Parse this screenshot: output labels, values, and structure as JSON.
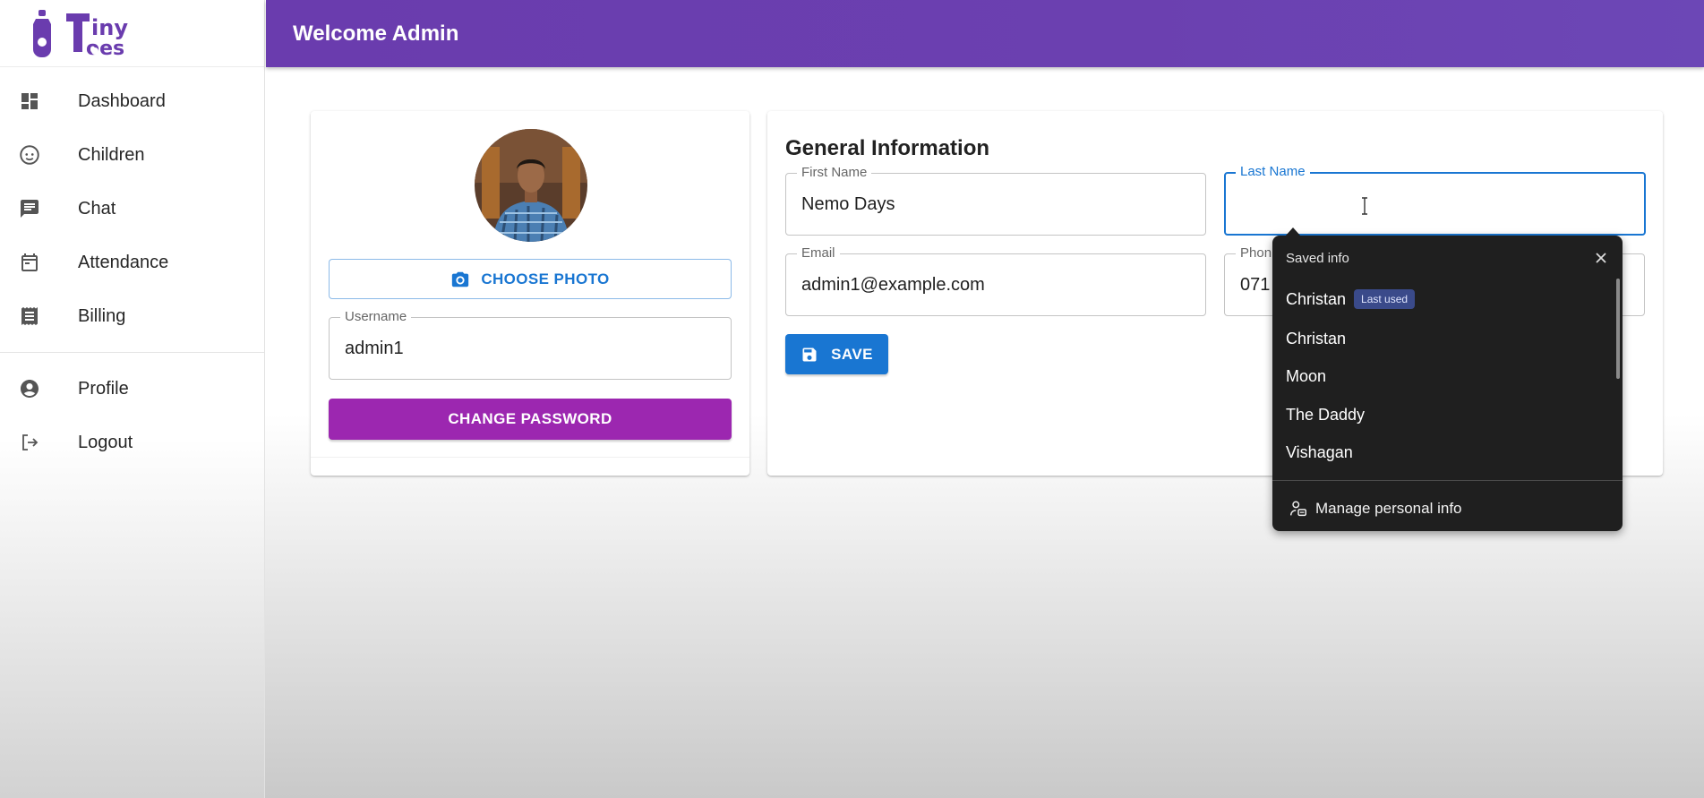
{
  "app": {
    "logo_text": "Tiny Toes",
    "header_title": "Welcome Admin"
  },
  "sidebar": {
    "items": [
      {
        "label": "Dashboard",
        "icon": "dashboard-icon"
      },
      {
        "label": "Children",
        "icon": "child-face-icon"
      },
      {
        "label": "Chat",
        "icon": "chat-icon"
      },
      {
        "label": "Attendance",
        "icon": "calendar-icon"
      },
      {
        "label": "Billing",
        "icon": "receipt-icon"
      }
    ],
    "secondary_items": [
      {
        "label": "Profile",
        "icon": "account-circle-icon"
      },
      {
        "label": "Logout",
        "icon": "logout-icon"
      }
    ]
  },
  "profile_card": {
    "choose_photo_label": "CHOOSE PHOTO",
    "username_label": "Username",
    "username_value": "admin1",
    "change_password_label": "CHANGE PASSWORD"
  },
  "general_info": {
    "title": "General Information",
    "first_name_label": "First Name",
    "first_name_value": "Nemo Days",
    "last_name_label": "Last Name",
    "last_name_value": "",
    "email_label": "Email",
    "email_value": "admin1@example.com",
    "phone_label": "Phon",
    "phone_value": "071",
    "save_label": "SAVE"
  },
  "autofill": {
    "heading": "Saved info",
    "badge": "Last used",
    "suggestions": [
      "Christan",
      "Christan",
      "Moon",
      "The Daddy",
      "Vishagan"
    ],
    "manage_label": "Manage personal info"
  },
  "colors": {
    "header_purple": "#6a3cae",
    "primary_blue": "#1976d2",
    "button_purple": "#9c27b0",
    "popup_bg": "#1f1f1f"
  }
}
